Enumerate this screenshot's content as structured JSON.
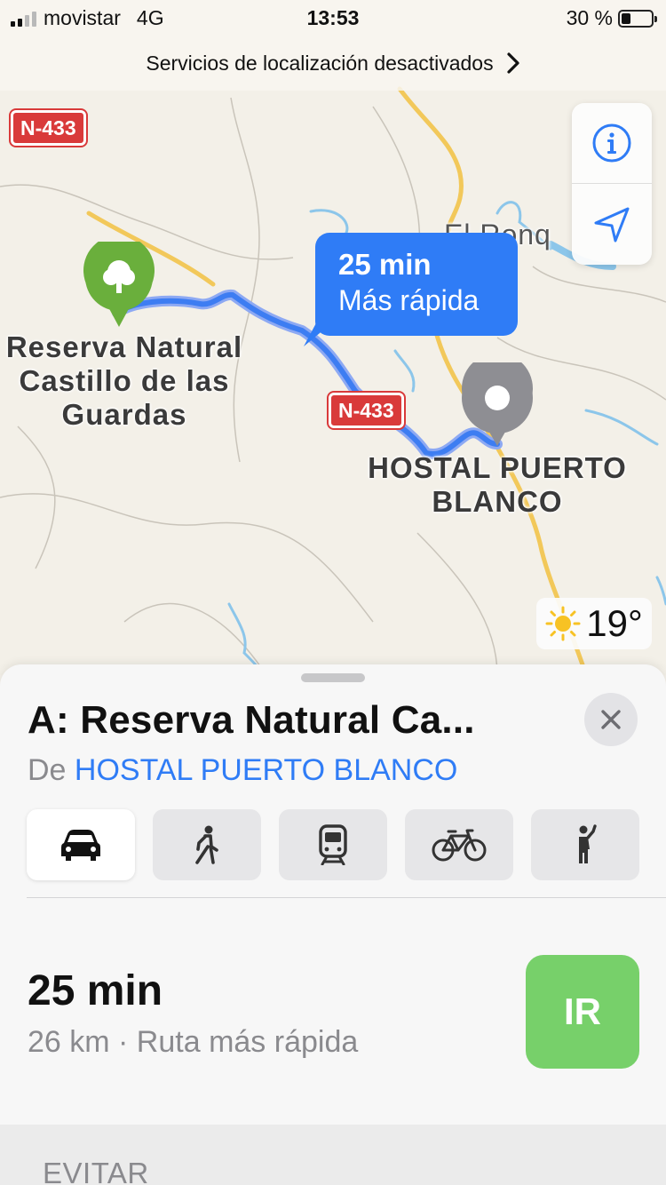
{
  "status_bar": {
    "carrier": "movistar",
    "network": "4G",
    "time": "13:53",
    "battery": "30 %",
    "battery_level": 0.3
  },
  "banner": {
    "text": "Servicios de localización desactivados"
  },
  "map": {
    "shields": [
      "N-433",
      "N-433"
    ],
    "origin_label": "Reserva Natural Castillo de las Guardas",
    "origin_lines": [
      "Reserva Natural",
      "Castillo de las",
      "Guardas"
    ],
    "destination_lines": [
      "HOSTAL PUERTO",
      "BLANCO"
    ],
    "town_label": "El Ronq",
    "route_bubble": {
      "time": "25 min",
      "label": "Más rápida"
    },
    "controls": [
      "info-icon",
      "location-arrow-icon"
    ],
    "weather": {
      "temp": "19°",
      "icon": "sun-icon"
    }
  },
  "sheet": {
    "title": "A: Reserva Natural Ca...",
    "from_prefix": "De",
    "from_place": "HOSTAL PUERTO BLANCO",
    "modes": [
      {
        "name": "car",
        "icon": "car-icon",
        "active": true
      },
      {
        "name": "walk",
        "icon": "walk-icon",
        "active": false
      },
      {
        "name": "transit",
        "icon": "train-icon",
        "active": false
      },
      {
        "name": "cycle",
        "icon": "bicycle-icon",
        "active": false
      },
      {
        "name": "ride",
        "icon": "ride-hail-icon",
        "active": false
      }
    ],
    "route": {
      "time": "25 min",
      "detail": "26 km · Ruta más rápida",
      "go_label": "IR"
    },
    "avoid_label": "EVITAR"
  },
  "colors": {
    "accent_blue": "#2f7cf6",
    "go_green": "#77d06a",
    "shield_red": "#d93a3a",
    "park_green": "#6aaf3c"
  }
}
